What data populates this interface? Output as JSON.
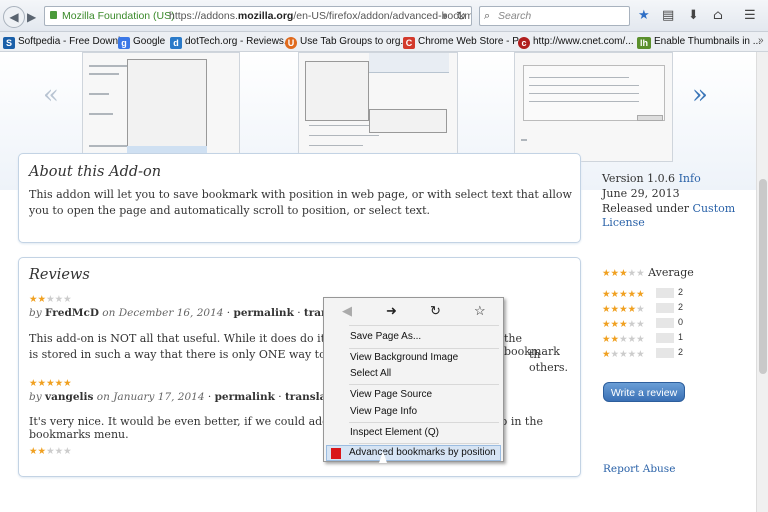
{
  "browser": {
    "org_label": "Mozilla Foundation (US)",
    "url_prefix": "https://addons.",
    "url_domain": "mozilla.org",
    "url_suffix": "/en-US/firefox/addon/advanced-bookmarks",
    "search_placeholder": "Search"
  },
  "bookmarks_bar": [
    {
      "label": "Softpedia - Free Downl...",
      "color": "#1a5fa8",
      "glyph": "S"
    },
    {
      "label": "Google",
      "color": "#3b78e7",
      "glyph": "g"
    },
    {
      "label": "dotTech.org - Reviews...",
      "color": "#2a7ac9",
      "glyph": "d"
    },
    {
      "label": "Use Tab Groups to org...",
      "color": "#e06a1d",
      "glyph": "U"
    },
    {
      "label": "Chrome Web Store - P...",
      "color": "#d33a2c",
      "glyph": "C"
    },
    {
      "label": "http://www.cnet.com/...",
      "color": "#b01e1e",
      "glyph": "c"
    },
    {
      "label": "Enable Thumbnails in ...",
      "color": "#5a8f2c",
      "glyph": "lh"
    }
  ],
  "about": {
    "title": "About this Add-on",
    "body": "This addon will let you to save bookmark with position in web page, or with select text that allow you to open the page and automatically scroll to position, or select text."
  },
  "sidebar": {
    "version_prefix": "Version 1.0.6 ",
    "info_link": "Info",
    "date": "June 29, 2013",
    "released_prefix": "Released under ",
    "license_link": "Custom License",
    "average_label": "Average",
    "rating_distribution": [
      {
        "stars": 5,
        "count": "2"
      },
      {
        "stars": 4,
        "count": "2"
      },
      {
        "stars": 3,
        "count": "0"
      },
      {
        "stars": 2,
        "count": "1"
      },
      {
        "stars": 1,
        "count": "2"
      }
    ],
    "average_stars": 3,
    "write_review": "Write a review",
    "report_abuse": "Report Abuse"
  },
  "reviews": {
    "title": "Reviews",
    "items": [
      {
        "stars": 2,
        "by": "by",
        "author": "FredMcD",
        "on": "on December 16, 2014",
        "permalink": "permalink",
        "translate": "translate",
        "body_left": "This add-on is NOT all that useful. While it does do its job of creating",
        "body_right": "the bookmark",
        "body2_left": "is stored in such a way that there is only ONE way to get at them. Als",
        "body2_right": "th others."
      },
      {
        "stars": 5,
        "by": "by",
        "author": "vangelis",
        "on": "on January 17, 2014",
        "permalink": "permalink",
        "translate": "translate",
        "body_left": "It's very nice. It would be even better, if we could add a shortcut button or move it up in the bookmarks menu."
      },
      {
        "stars": 2
      }
    ],
    "separator": "·"
  },
  "context_menu": {
    "save_page": "Save Page As...",
    "view_bg": "View Background Image",
    "select_all": "Select All",
    "view_source": "View Page Source",
    "view_info": "View Page Info",
    "inspect": "Inspect Element (Q)",
    "advanced": "Advanced bookmarks by position"
  },
  "icons": {
    "back": "back-arrow-icon",
    "forward": "forward-arrow-icon",
    "reload": "reload-icon",
    "bookmark": "star-icon"
  }
}
